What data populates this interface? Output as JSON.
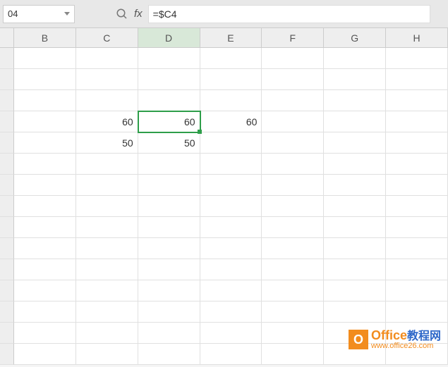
{
  "name_box": {
    "value": "04"
  },
  "formula_bar": {
    "fx_label": "fx",
    "value": "=$C4"
  },
  "columns": [
    "B",
    "C",
    "D",
    "E",
    "F",
    "G",
    "H"
  ],
  "active_column": "D",
  "selected_cell": "D4",
  "cells": {
    "C4": "60",
    "D4": "60",
    "E4": "60",
    "C5": "50",
    "D5": "50"
  },
  "watermark": {
    "icon_letter": "O",
    "title_en": "Office",
    "title_cn": "教程网",
    "url": "www.office26.com"
  }
}
